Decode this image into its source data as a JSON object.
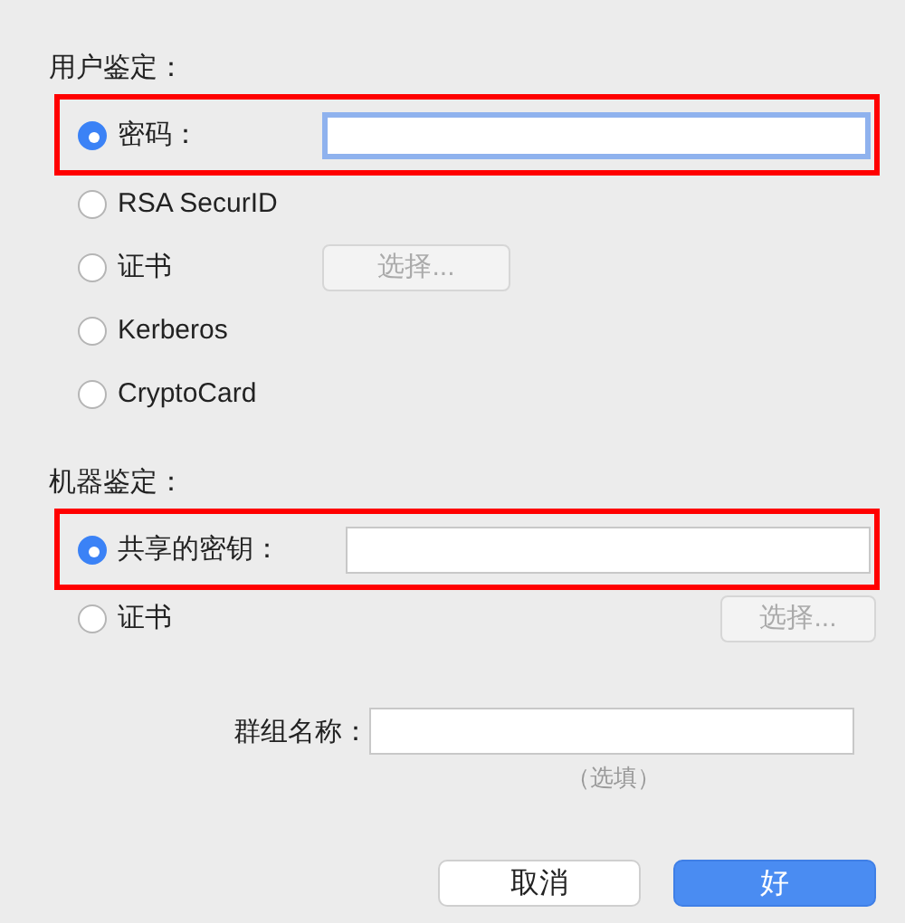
{
  "sections": [
    {
      "heading": "用户鉴定：",
      "options": [
        {
          "kind": "field",
          "label": "密码：",
          "selected": true,
          "highlighted": true,
          "focused": true
        },
        {
          "kind": "plain",
          "label": "RSA SecurID",
          "selected": false,
          "highlighted": false
        },
        {
          "kind": "button",
          "label": "证书",
          "selected": false,
          "highlighted": false,
          "button": {
            "label": "选择...",
            "disabled": true
          }
        },
        {
          "kind": "plain",
          "label": "Kerberos",
          "selected": false,
          "highlighted": false
        },
        {
          "kind": "plain",
          "label": "CryptoCard",
          "selected": false,
          "highlighted": false
        }
      ]
    },
    {
      "heading": "机器鉴定：",
      "options": [
        {
          "kind": "field",
          "label": "共享的密钥：",
          "selected": true,
          "highlighted": true,
          "focused": false
        },
        {
          "kind": "button",
          "label": "证书",
          "selected": false,
          "highlighted": false,
          "button": {
            "label": "选择...",
            "disabled": true
          }
        }
      ]
    }
  ],
  "group_name": {
    "label": "群组名称：",
    "hint": "（选填）"
  },
  "buttons": [
    {
      "label": "取消",
      "default": false
    },
    {
      "label": "好",
      "default": true
    }
  ]
}
